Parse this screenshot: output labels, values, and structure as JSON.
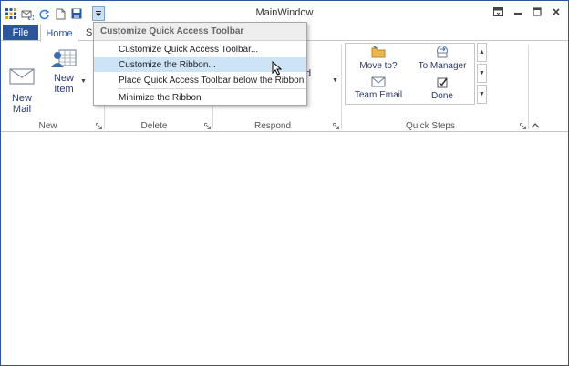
{
  "window": {
    "title": "MainWindow"
  },
  "qat": {
    "icons": [
      "app-grid-icon",
      "send-receive-icon",
      "refresh-icon",
      "new-page-icon",
      "save-icon"
    ],
    "dropdown_icon": "customize-dropdown-icon"
  },
  "controls": [
    "ribbon-display-icon",
    "minimize-icon",
    "maximize-icon",
    "close-icon"
  ],
  "tabs": {
    "file": "File",
    "home": "Home",
    "partial": "S"
  },
  "ribbon": {
    "new_mail": "New Mail",
    "new_item": "New Item",
    "partial_respond_text": "d",
    "groups": {
      "new": "New",
      "delete": "Delete",
      "respond": "Respond",
      "quick_steps": "Quick Steps"
    },
    "quick_steps": [
      {
        "label": "Move to?",
        "icon": "folder-move-icon"
      },
      {
        "label": "To Manager",
        "icon": "forward-mail-icon"
      },
      {
        "label": "Team Email",
        "icon": "envelope-icon"
      },
      {
        "label": "Done",
        "icon": "checkbox-icon"
      }
    ]
  },
  "menu": {
    "header": "Customize Quick Access Toolbar",
    "items": [
      "Customize Quick Access Toolbar...",
      "Customize the Ribbon...",
      "Place Quick Access Toolbar below the Ribbon",
      "Minimize the Ribbon"
    ],
    "hover_index": 1
  },
  "colors": {
    "accent": "#2b579a",
    "menu_hover": "#cde4f7",
    "label_blue": "#2b3a6a"
  }
}
